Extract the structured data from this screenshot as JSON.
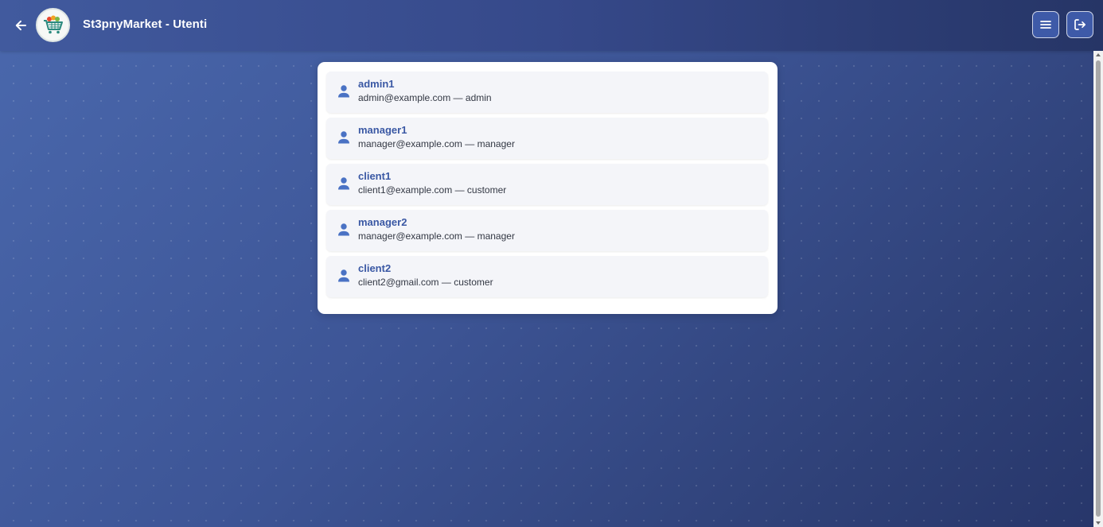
{
  "header": {
    "title": "St3pnyMarket - Utenti",
    "back_icon": "arrow-left-icon",
    "menu_icon": "hamburger-menu-icon",
    "logout_icon": "logout-icon",
    "logo_name": "st3pnymarket-logo"
  },
  "users": [
    {
      "username": "admin1",
      "details": "admin@example.com — admin"
    },
    {
      "username": "manager1",
      "details": "manager@example.com — manager"
    },
    {
      "username": "client1",
      "details": "client1@example.com — customer"
    },
    {
      "username": "manager2",
      "details": "manager@example.com — manager"
    },
    {
      "username": "client2",
      "details": "client2@gmail.com — customer"
    }
  ],
  "colors": {
    "accent": "#3a58a4",
    "icon": "#4a72c4",
    "card_bg": "#ffffff",
    "item_bg": "#f4f5f9"
  }
}
